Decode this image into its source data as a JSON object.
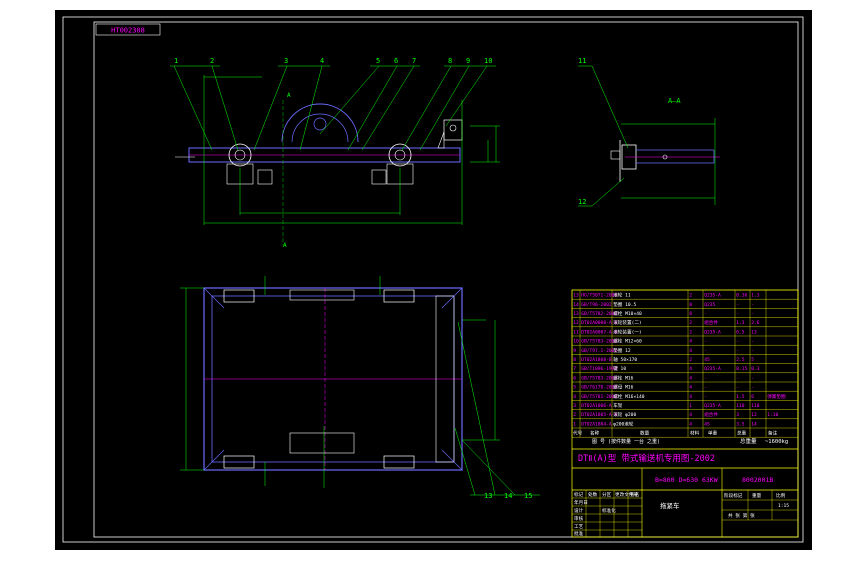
{
  "drawing": {
    "code_tag": "HT002308",
    "section_label": "A—A",
    "section_marks": [
      "A",
      "A"
    ],
    "balloons_top": [
      "1",
      "2",
      "3",
      "4",
      "5",
      "6",
      "7",
      "8",
      "9",
      "10"
    ],
    "balloon_11": "11",
    "balloon_12": "12",
    "balloons_bottom": [
      "13",
      "14",
      "15"
    ]
  },
  "title_block": {
    "main_title": "DTⅡ(A)型 带式输送机专用图-2002",
    "spec": "B=800 D=630 63KW",
    "drawing_no": "8002001B",
    "name": "拖紧车",
    "scale": "1:15",
    "weight_label": "总重量",
    "weight_value": "~1600kg",
    "total_row": "图 号 (按件数量 一台 之重)",
    "header_cols": [
      "代号",
      "名称",
      "数量",
      "材料",
      "单重",
      "总重",
      "备注"
    ],
    "parts_rows": [
      [
        "13",
        "HG/T5071-2000",
        "滚轮 11",
        "2",
        "Q235-A",
        "0.36",
        "1.3",
        ""
      ],
      [
        "14",
        "GB/T96-2002",
        "垫圈 10.5",
        "8",
        "Q235",
        "-",
        "-",
        ""
      ],
      [
        "13",
        "GB/T5782-2000",
        "螺栓 M10×40",
        "8",
        "-",
        "-",
        "-",
        ""
      ],
      [
        "12",
        "DT02A0008-A-B",
        "滚轮装置(二)",
        "2",
        "组合件",
        "1.3",
        "2.6",
        ""
      ],
      [
        "11",
        "DT02A0007-A-B",
        "滚轮装置(一)",
        "2",
        "Q235-A",
        "6.5",
        "13",
        ""
      ],
      [
        "10",
        "GB/T5783-2000",
        "螺栓 M12×60",
        "4",
        "-",
        "-",
        "-",
        ""
      ],
      [
        "9",
        "GB/T97.1-2002",
        "垫圈 12",
        "4",
        "-",
        "-",
        "-",
        ""
      ],
      [
        "8",
        "DT02A1808-B",
        "轴 50×170",
        "2",
        "45",
        "2.5",
        "5",
        ""
      ],
      [
        "7",
        "GB/T1096-1998",
        "键 10",
        "4",
        "Q235-A",
        "0.15",
        "0.3",
        ""
      ],
      [
        "6",
        "GB/T5783-2000",
        "螺栓 M16",
        "4",
        "-",
        "-",
        "-",
        ""
      ],
      [
        "5",
        "GB/T6170-2000",
        "螺母 M16",
        "4",
        "-",
        "-",
        "-",
        ""
      ],
      [
        "4",
        "GB/T5781-2000",
        "螺栓 M16×140",
        "4",
        "-",
        "1.5",
        "6",
        "弹簧垫圈"
      ],
      [
        "3",
        "DT02A1806-A",
        "车架",
        "1",
        "Q235-A",
        "110",
        "110",
        ""
      ],
      [
        "2",
        "DT02A1805-A-B",
        "滚轮 φ200",
        "4",
        "组合件",
        "3",
        "12",
        "1:10"
      ],
      [
        "1",
        "DT02A1804-A",
        "φ200滚轮",
        "4",
        "45",
        "3.5",
        "14",
        ""
      ]
    ],
    "sign_rows": [
      "标记",
      "处数",
      "分区",
      "更改文件号",
      "签名",
      "年月日"
    ],
    "sign_labels": [
      "设计",
      "审核",
      "工艺",
      "批准",
      "标准化"
    ],
    "stage_labels": [
      "阶段标记",
      "重量",
      "比例"
    ],
    "sheet": "共 张 第 张"
  },
  "colors": {
    "background": "#000000",
    "page": "#ffffff",
    "line": "#00ff00",
    "frame": "#ffffff",
    "table": "#ffff00",
    "text": "#ff00ff",
    "parts": "#6b6bff"
  }
}
